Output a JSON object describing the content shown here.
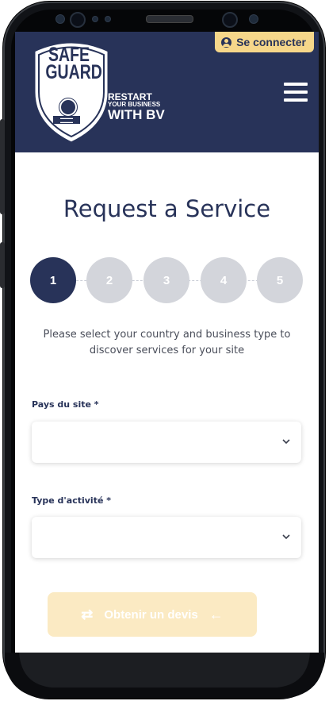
{
  "header": {
    "connect_label": "Se connecter",
    "logo_line1": "SAFE",
    "logo_line2": "GUARD",
    "tagline_1": "RESTART",
    "tagline_2": "YOUR BUSINESS",
    "tagline_3": "WITH BV"
  },
  "main": {
    "title": "Request a Service",
    "steps": [
      "1",
      "2",
      "3",
      "4",
      "5"
    ],
    "active_step": 1,
    "instructions": "Please select your country and business type to discover services for your site",
    "country_label": "Pays du site *",
    "country_value": "",
    "activity_label": "Type d'activité *",
    "activity_value": "",
    "quote_button": "Obtenir un devis"
  },
  "colors": {
    "navy": "#283359",
    "accent_yellow": "#f6d78a",
    "step_inactive": "#d3d5db",
    "button_disabled": "#fbeac3"
  }
}
